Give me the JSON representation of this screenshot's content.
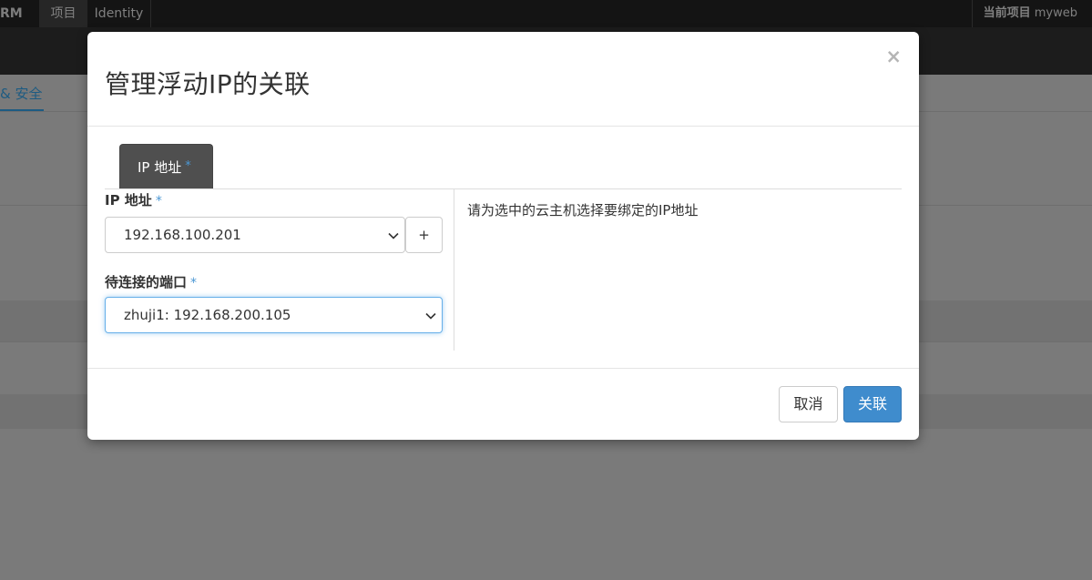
{
  "nav": {
    "brand": "RM",
    "tabs": [
      {
        "label": "项目",
        "active": true
      },
      {
        "label": "Identity",
        "active": false
      }
    ],
    "project_label": "当前项目",
    "project_name": "myweb"
  },
  "page_tab": "& 安全",
  "modal": {
    "title": "管理浮动IP的关联",
    "close": "×",
    "tab_label": "IP 地址",
    "required_mark": "*",
    "ip_field": {
      "label": "IP 地址",
      "value": "192.168.100.201",
      "add_label": "+"
    },
    "port_field": {
      "label": "待连接的端口",
      "value": "zhuji1: 192.168.200.105"
    },
    "help_text": "请为选中的云主机选择要绑定的IP地址",
    "cancel_label": "取消",
    "confirm_label": "关联"
  },
  "colors": {
    "accent": "#3f8ccd",
    "required": "#4b97d4"
  }
}
